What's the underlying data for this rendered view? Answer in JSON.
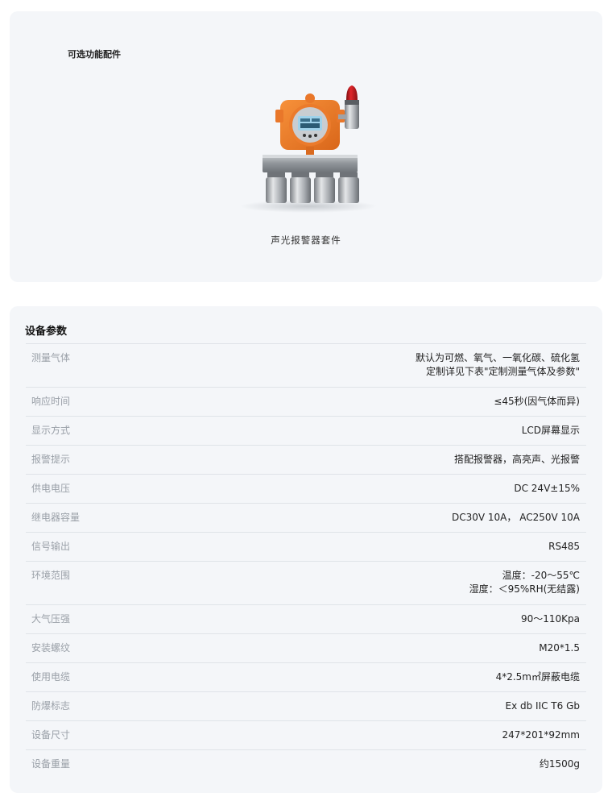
{
  "accessories": {
    "title": "可选功能配件",
    "caption": "声光报警器套件"
  },
  "params": {
    "title": "设备参数",
    "rows": [
      {
        "label": "测量气体",
        "value": [
          "默认为可燃、氧气、一氧化碳、硫化氢",
          "定制详见下表\"定制测量气体及参数\""
        ]
      },
      {
        "label": "响应时间",
        "value": [
          "≤45秒(因气体而异)"
        ]
      },
      {
        "label": "显示方式",
        "value": [
          "LCD屏幕显示"
        ]
      },
      {
        "label": "报警提示",
        "value": [
          "搭配报警器，高亮声、光报警"
        ]
      },
      {
        "label": "供电电压",
        "value": [
          "DC 24V±15%"
        ]
      },
      {
        "label": "继电器容量",
        "value": [
          "DC30V 10A， AC250V 10A"
        ]
      },
      {
        "label": "信号输出",
        "value": [
          "RS485"
        ]
      },
      {
        "label": "环境范围",
        "value": [
          "温度：-20～55℃",
          "湿度：＜95%RH(无结露)"
        ]
      },
      {
        "label": "大气压强",
        "value": [
          "90～110Kpa"
        ]
      },
      {
        "label": "安装螺纹",
        "value": [
          "M20*1.5"
        ]
      },
      {
        "label": "使用电缆",
        "value": [
          "4*2.5m㎡屏蔽电缆"
        ]
      },
      {
        "label": "防爆标志",
        "value": [
          "Ex db IIC T6 Gb"
        ]
      },
      {
        "label": "设备尺寸",
        "value": [
          "247*201*92mm"
        ]
      },
      {
        "label": "设备重量",
        "value": [
          "约1500g"
        ]
      }
    ]
  }
}
